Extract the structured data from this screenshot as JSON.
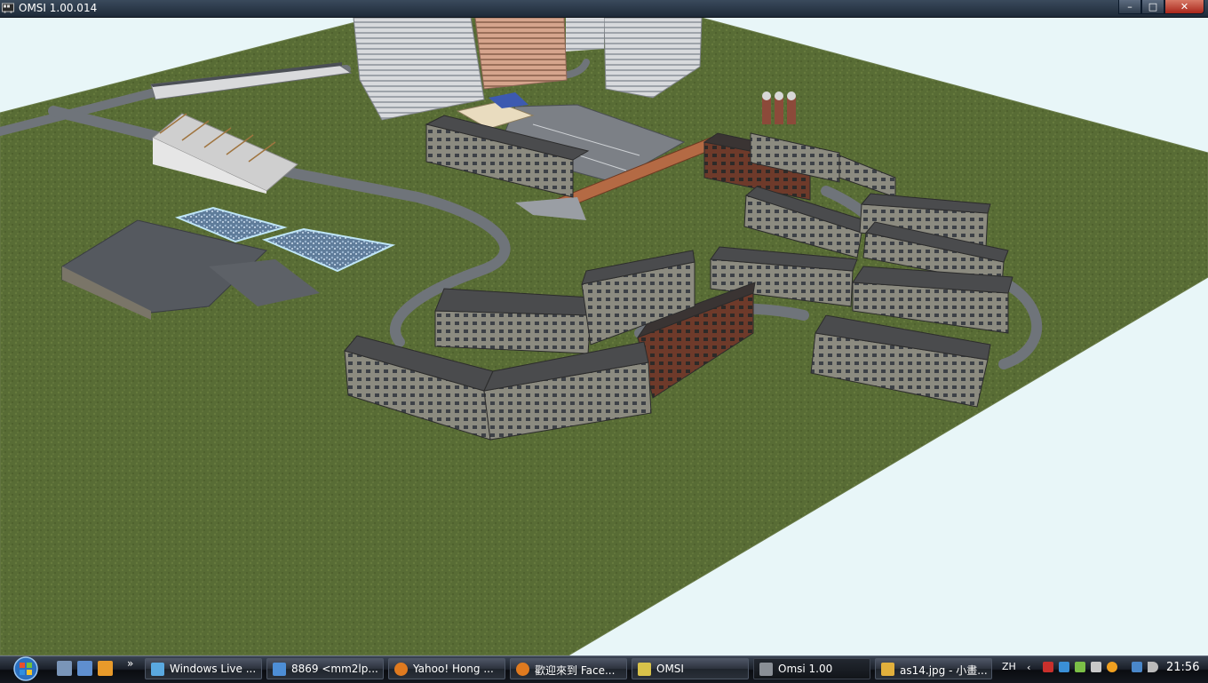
{
  "window": {
    "title": "OMSI 1.00.014",
    "controls": {
      "minimize": "–",
      "maximize": "□",
      "close": "✕"
    }
  },
  "taskbar": {
    "start_icon": "windows-orb-icon",
    "overflow_label": "»",
    "quick_launch": [
      "show-desktop-icon",
      "switch-windows-icon",
      "media-player-icon"
    ],
    "buttons": [
      {
        "label": "Windows Live ...",
        "icon": "windows-live-icon",
        "color": "#5aa9e0"
      },
      {
        "label": "8869 <mm2lp...",
        "icon": "messenger-icon",
        "color": "#4d8ed6"
      },
      {
        "label": "Yahoo! Hong ...",
        "icon": "firefox-icon",
        "color": "#e07a1f"
      },
      {
        "label": "歡迎來到 Face...",
        "icon": "firefox-icon",
        "color": "#e07a1f"
      },
      {
        "label": "OMSI",
        "icon": "folder-icon",
        "color": "#d8c24a"
      },
      {
        "label": "Omsi 1.00",
        "icon": "omsi-bus-icon",
        "color": "#8a8f96"
      },
      {
        "label": "as14.jpg - 小畫...",
        "icon": "paint-icon",
        "color": "#e2b03c"
      }
    ],
    "active_index": 5,
    "tray": {
      "language": "ZH",
      "icons": [
        "expand-arrow-icon",
        "pdf-icon",
        "network-icon",
        "security-icon",
        "usb-icon",
        "update-icon",
        "network-status-icon",
        "volume-icon"
      ],
      "clock": "21:56"
    }
  },
  "colors": {
    "grass": "#556b33",
    "sky": "#e8f6f8",
    "road": "#6e7379",
    "taskbar": "#1a1f28"
  }
}
